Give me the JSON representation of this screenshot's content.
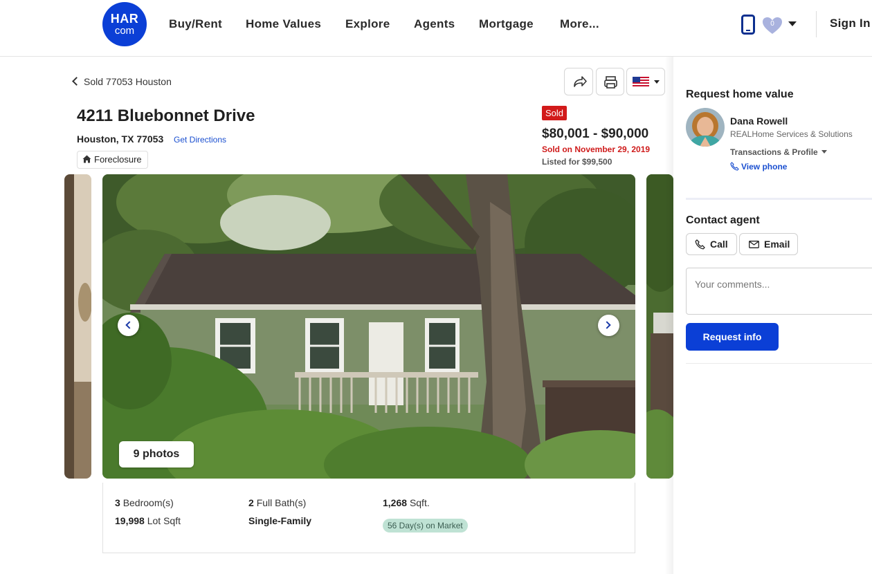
{
  "header": {
    "logo_top": "HAR",
    "logo_bottom": "com",
    "nav": [
      "Buy/Rent",
      "Home Values",
      "Explore",
      "Agents",
      "Mortgage",
      "More..."
    ],
    "favorites_count": "0",
    "sign_in": "Sign In"
  },
  "breadcrumb": {
    "back_label": "Sold 77053 Houston"
  },
  "listing": {
    "address": "4211 Bluebonnet Drive",
    "city_line": "Houston, TX 77053",
    "directions_link": "Get Directions",
    "tag": "Foreclosure",
    "status_badge": "Sold",
    "price_range": "$80,001 - $90,000",
    "sold_on": "Sold on November 29, 2019",
    "listed_for": "Listed for $99,500",
    "photos_label": "9 photos"
  },
  "facts": {
    "bedrooms_value": "3",
    "bedrooms_label": "Bedroom(s)",
    "baths_value": "2",
    "baths_label": "Full Bath(s)",
    "sqft_value": "1,268",
    "sqft_label": "Sqft.",
    "lot_value": "19,998",
    "lot_label": "Lot Sqft",
    "property_type": "Single-Family",
    "days_on_market": "56 Day(s) on Market"
  },
  "sidebar": {
    "request_title": "Request home value",
    "agent_name": "Dana Rowell",
    "agent_company": "REALHome Services & Solutions",
    "transactions_label": "Transactions & Profile",
    "view_phone": "View phone",
    "contact_title": "Contact agent",
    "call_label": "Call",
    "email_label": "Email",
    "comments_placeholder": "Your comments...",
    "request_button": "Request info"
  },
  "colors": {
    "brand_blue": "#0b3fd6",
    "sold_red": "#d21a1a",
    "dom_green": "#bfe2d4"
  },
  "icons": [
    "phone-icon",
    "heart-icon",
    "share-icon",
    "print-icon",
    "us-flag-icon",
    "home-icon",
    "call-icon",
    "email-icon"
  ]
}
